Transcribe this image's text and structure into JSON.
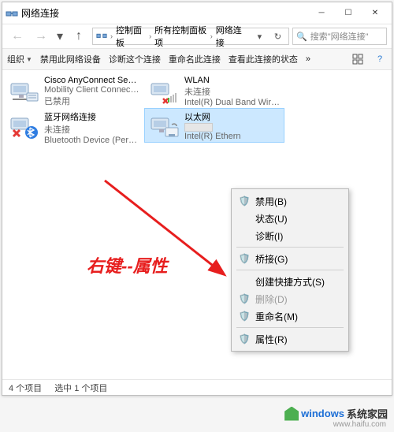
{
  "window": {
    "title": "网络连接"
  },
  "nav": {
    "crumbs": [
      "控制面板",
      "所有控制面板项",
      "网络连接"
    ]
  },
  "search": {
    "placeholder": "搜索\"网络连接\""
  },
  "toolbar": {
    "organize": "组织",
    "disable": "禁用此网络设备",
    "diagnose": "诊断这个连接",
    "rename": "重命名此连接",
    "status": "查看此连接的状态",
    "more": "»"
  },
  "items": [
    {
      "line1": "Cisco AnyConnect Secure",
      "line2": "Mobility Client Connection",
      "line3": "已禁用"
    },
    {
      "line1": "WLAN",
      "line2": "未连接",
      "line3": "Intel(R) Dual Band Wireless-A..."
    },
    {
      "line1": "蓝牙网络连接",
      "line2": "未连接",
      "line3": "Bluetooth Device (Personal Ar..."
    },
    {
      "line1": "以太网",
      "line2": "",
      "line3": "Intel(R) Ethern"
    }
  ],
  "context_menu": {
    "disable": "禁用(B)",
    "status": "状态(U)",
    "diagnose": "诊断(I)",
    "bridge": "桥接(G)",
    "shortcut": "创建快捷方式(S)",
    "delete": "删除(D)",
    "rename": "重命名(M)",
    "properties": "属性(R)"
  },
  "status": {
    "count": "4 个项目",
    "selected": "选中 1 个项目"
  },
  "hint": "右键--属性",
  "watermark": {
    "text1": "windows",
    "text2": "系统家园",
    "url": "www.haifu.com"
  }
}
